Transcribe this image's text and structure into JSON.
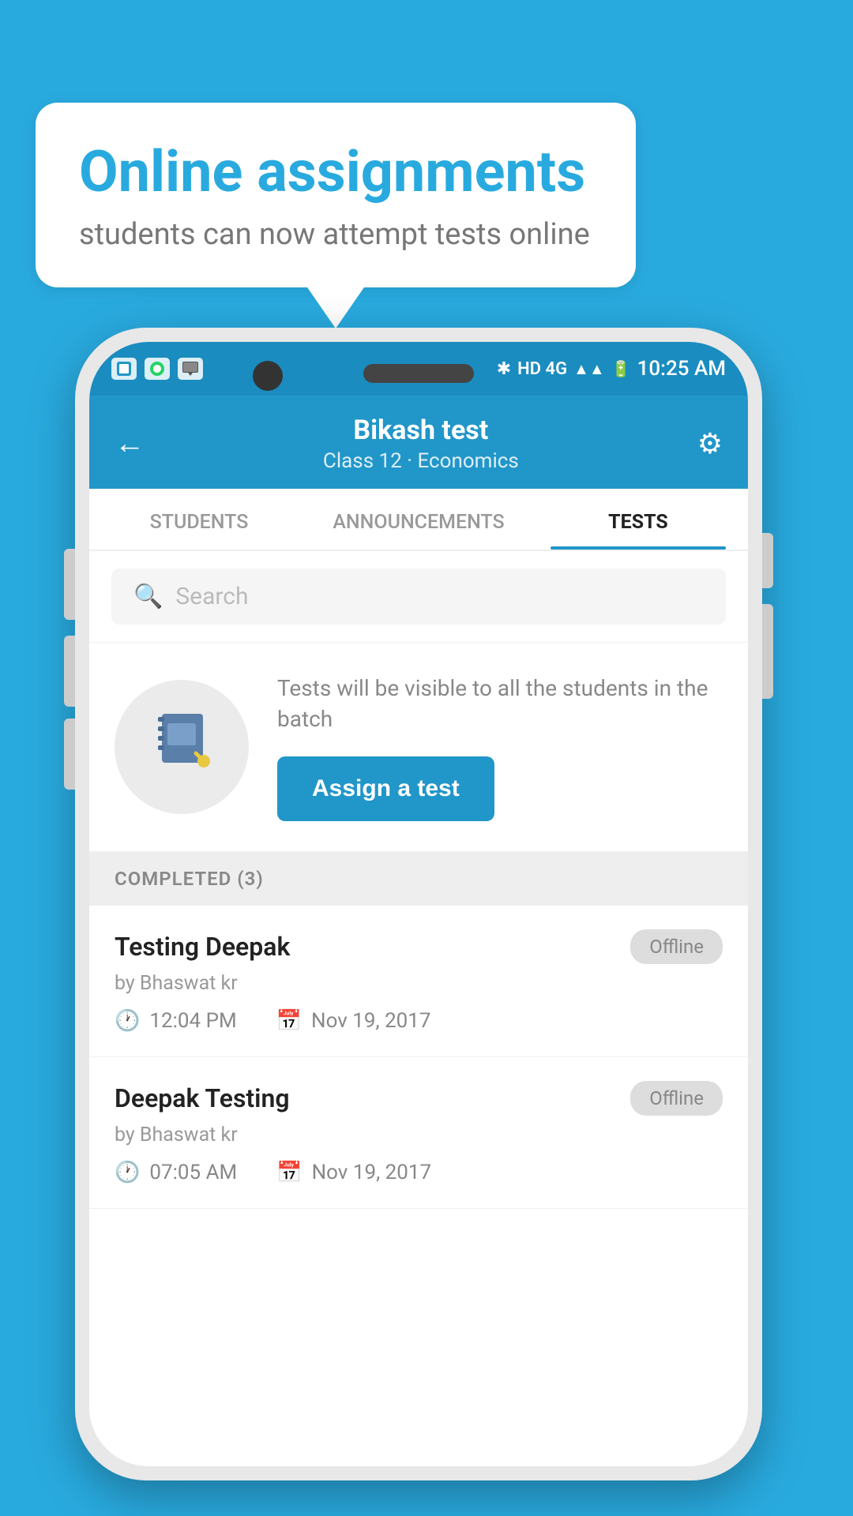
{
  "bubble": {
    "title": "Online assignments",
    "subtitle": "students can now attempt tests online"
  },
  "status_bar": {
    "time": "10:25 AM",
    "network": "HD 4G"
  },
  "header": {
    "title": "Bikash test",
    "subtitle": "Class 12 · Economics",
    "back_label": "←",
    "settings_label": "⚙"
  },
  "tabs": [
    {
      "label": "STUDENTS",
      "active": false
    },
    {
      "label": "ANNOUNCEMENTS",
      "active": false
    },
    {
      "label": "TESTS",
      "active": true
    }
  ],
  "search": {
    "placeholder": "Search"
  },
  "assign": {
    "description": "Tests will be visible to all the students in the batch",
    "button_label": "Assign a test"
  },
  "completed": {
    "label": "COMPLETED (3)"
  },
  "test_items": [
    {
      "title": "Testing Deepak",
      "by": "by Bhaswat kr",
      "time": "12:04 PM",
      "date": "Nov 19, 2017",
      "badge": "Offline"
    },
    {
      "title": "Deepak Testing",
      "by": "by Bhaswat kr",
      "time": "07:05 AM",
      "date": "Nov 19, 2017",
      "badge": "Offline"
    }
  ],
  "icons": {
    "back": "←",
    "settings": "⚙",
    "search": "🔍",
    "clock": "🕐",
    "calendar": "📅",
    "notebook": "📓"
  }
}
